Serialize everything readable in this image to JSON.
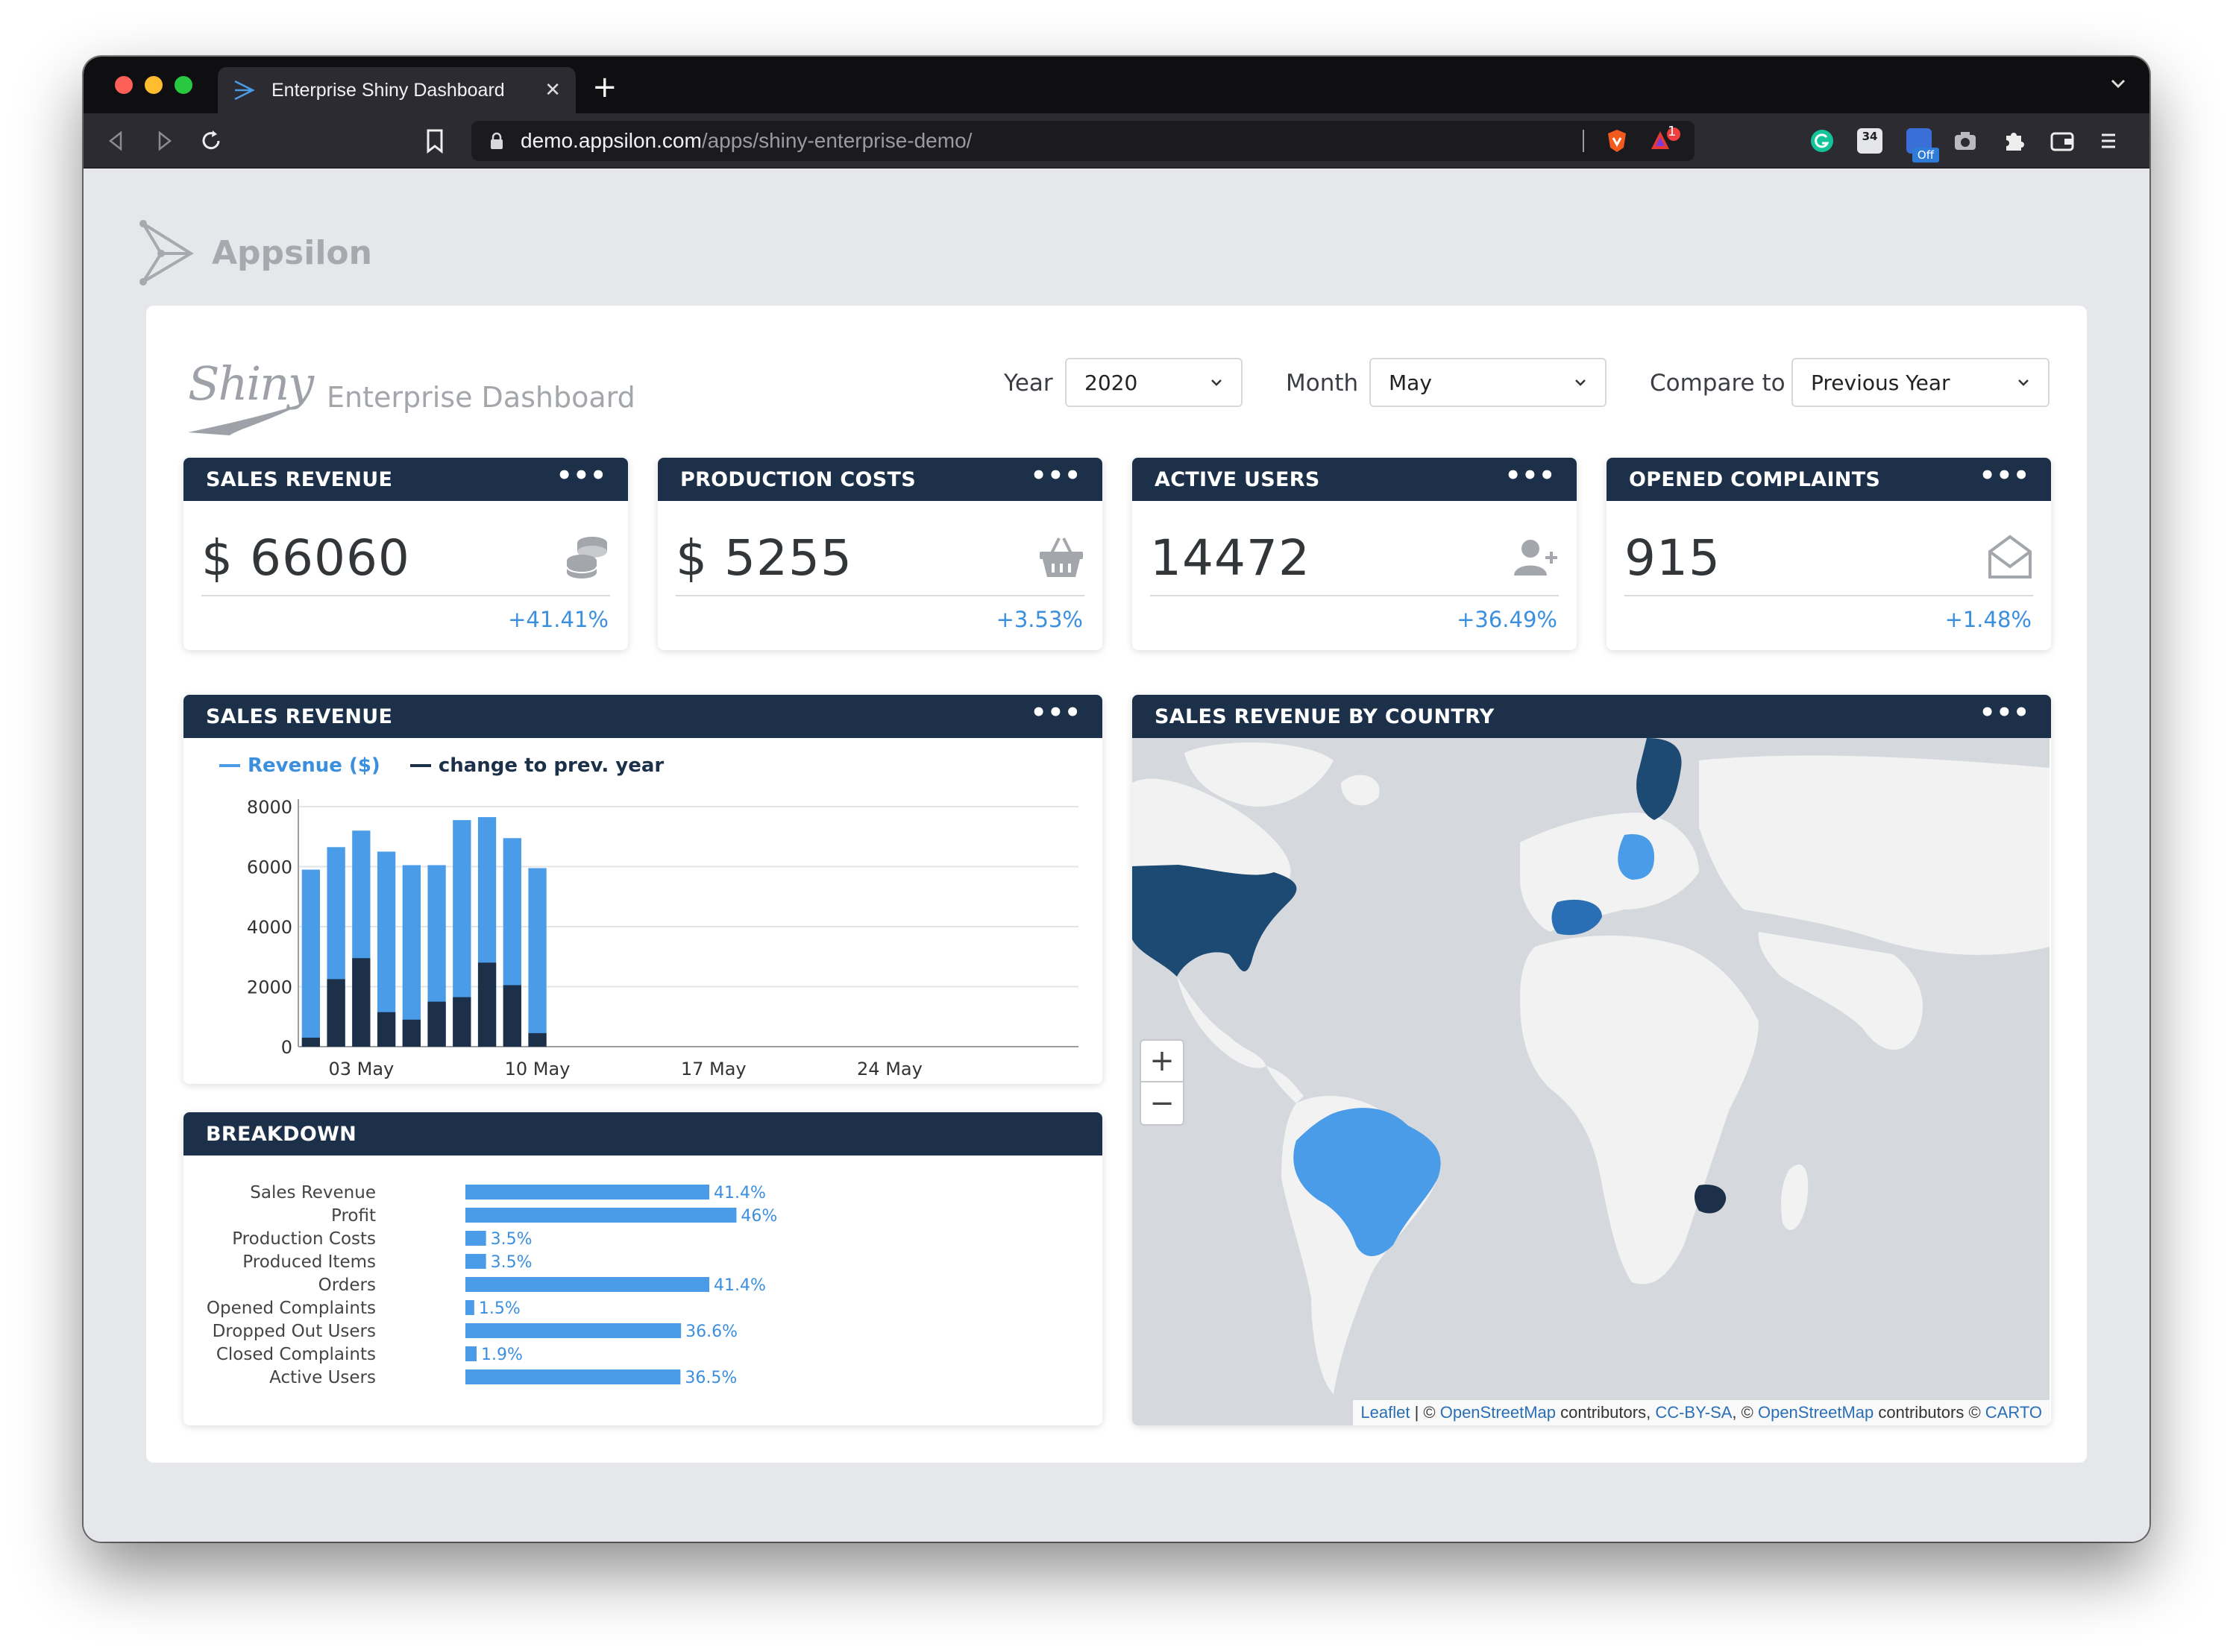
{
  "browser": {
    "tab_title": "Enterprise Shiny Dashboard",
    "url_host": "demo.appsilon.com",
    "url_path": "/apps/shiny-enterprise-demo/",
    "new_tab_label": "+",
    "close_label": "✕",
    "extension_badge_count": "1",
    "extension_calendar_label": "34",
    "extension_off_label": "Off"
  },
  "brand": {
    "name": "Appsilon"
  },
  "dashboard": {
    "shiny_word": "Shiny",
    "title": "Enterprise Dashboard",
    "filters": {
      "year_label": "Year",
      "year_value": "2020",
      "month_label": "Month",
      "month_value": "May",
      "compare_label": "Compare to",
      "compare_value": "Previous Year"
    }
  },
  "kpis": [
    {
      "title": "SALES REVENUE",
      "value": "$ 66060",
      "change": "+41.41%",
      "icon": "coins-icon"
    },
    {
      "title": "PRODUCTION COSTS",
      "value": "$ 5255",
      "change": "+3.53%",
      "icon": "basket-icon"
    },
    {
      "title": "ACTIVE USERS",
      "value": "14472",
      "change": "+36.49%",
      "icon": "user-plus-icon"
    },
    {
      "title": "OPENED COMPLAINTS",
      "value": "915",
      "change": "+1.48%",
      "icon": "envelope-open-icon"
    }
  ],
  "menu_dots": "•••",
  "revenue_chart": {
    "title": "SALES REVENUE",
    "legend": [
      "Revenue ($)",
      "change to prev. year"
    ]
  },
  "breakdown": {
    "title": "BREAKDOWN"
  },
  "map": {
    "title": "SALES REVENUE BY COUNTRY",
    "zoom_in": "+",
    "zoom_out": "−",
    "attribution": {
      "leaflet": "Leaflet",
      "sep1": " | © ",
      "osm1": "OpenStreetMap",
      "contrib1": " contributors, ",
      "ccbysa": "CC-BY-SA",
      "sep2": ", © ",
      "osm2": "OpenStreetMap",
      "contrib2": " contributors © ",
      "carto": "CARTO"
    }
  },
  "colors": {
    "header_bg": "#1c3149",
    "revenue_bar": "#4a9be8",
    "change_bar": "#1c3149",
    "accent_text": "#3b8fdf"
  },
  "chart_data": [
    {
      "type": "bar",
      "title": "SALES REVENUE",
      "x_tick_labels": [
        "03 May",
        "10 May",
        "17 May",
        "24 May"
      ],
      "y_ticks": [
        0,
        2000,
        4000,
        6000,
        8000
      ],
      "ylim": [
        0,
        8000
      ],
      "x_range_days": [
        "2020-05-01",
        "2020-05-31"
      ],
      "categories": [
        "2020-05-01",
        "2020-05-02",
        "2020-05-03",
        "2020-05-04",
        "2020-05-05",
        "2020-05-06",
        "2020-05-07",
        "2020-05-08",
        "2020-05-09",
        "2020-05-10"
      ],
      "series": [
        {
          "name": "Revenue ($)",
          "values": [
            5900,
            6650,
            7200,
            6500,
            6050,
            6050,
            7550,
            7650,
            6950,
            5950
          ]
        },
        {
          "name": "change to prev. year",
          "values": [
            300,
            2250,
            2950,
            1150,
            900,
            1500,
            1650,
            2800,
            2050,
            450
          ]
        }
      ],
      "legend_position": "top-left",
      "grid": true
    },
    {
      "type": "bar",
      "title": "BREAKDOWN",
      "orientation": "horizontal",
      "categories": [
        "Sales Revenue",
        "Profit",
        "Production Costs",
        "Produced Items",
        "Orders",
        "Opened Complaints",
        "Dropped Out Users",
        "Closed Complaints",
        "Active Users"
      ],
      "values": [
        41.4,
        46,
        3.5,
        3.5,
        41.4,
        1.5,
        36.6,
        1.9,
        36.5
      ],
      "value_labels": [
        "41.4%",
        "46%",
        "3.5%",
        "3.5%",
        "41.4%",
        "1.5%",
        "36.6%",
        "1.9%",
        "36.5%"
      ]
    }
  ]
}
